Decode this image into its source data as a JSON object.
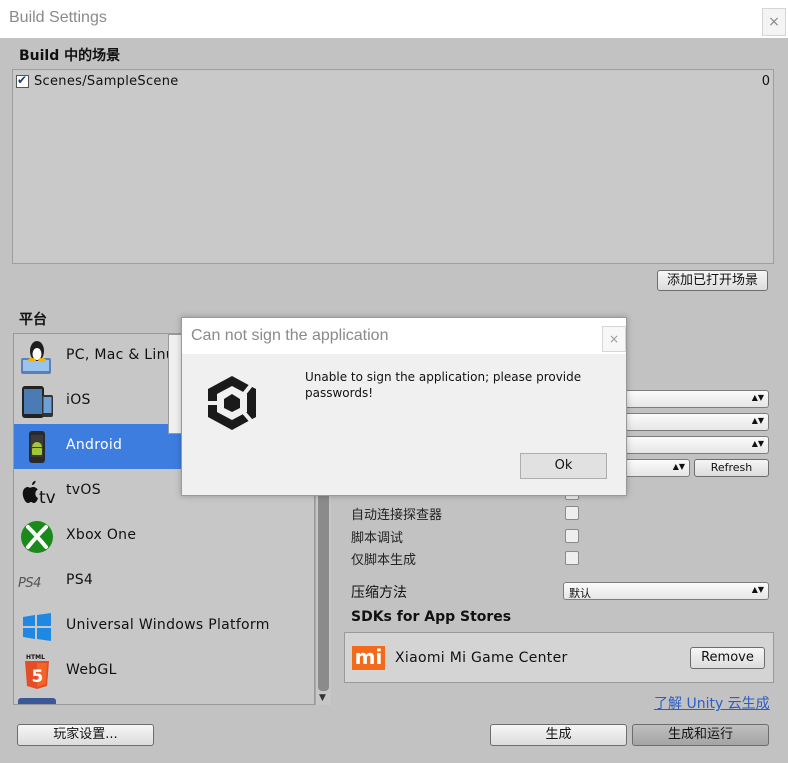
{
  "window": {
    "title": "Build Settings",
    "close_glyph": "×"
  },
  "scenes": {
    "section_label": "Build 中的场景",
    "items": [
      {
        "name": "Scenes/SampleScene",
        "index": "0",
        "checked": true
      }
    ],
    "add_open_button": "添加已打开场景"
  },
  "platforms": {
    "section_label": "平台",
    "items": [
      {
        "label": "PC, Mac & Linux Standalone",
        "icon": "pc-mac-linux-icon"
      },
      {
        "label": "iOS",
        "icon": "ios-icon"
      },
      {
        "label": "Android",
        "icon": "android-icon",
        "selected": true
      },
      {
        "label": "tvOS",
        "icon": "tvos-icon"
      },
      {
        "label": "Xbox One",
        "icon": "xbox-icon"
      },
      {
        "label": "PS4",
        "icon": "ps4-icon"
      },
      {
        "label": "Universal Windows Platform",
        "icon": "windows-icon"
      },
      {
        "label": "WebGL",
        "icon": "html5-icon"
      }
    ]
  },
  "settings": {
    "refresh_button": "Refresh",
    "options": [
      {
        "label": "自动连接探查器",
        "checked": false
      },
      {
        "label": "脚本调试",
        "checked": false
      },
      {
        "label": "仅脚本生成",
        "checked": false
      }
    ],
    "compression_label": "压缩方法",
    "compression_value": "默认"
  },
  "sdks": {
    "section_label": "SDKs for App Stores",
    "items": [
      {
        "name": "Xiaomi Mi Game Center",
        "logo_text": "mi",
        "button": "Remove"
      }
    ],
    "learn_link": "了解 Unity 云生成"
  },
  "bottom": {
    "player_settings": "玩家设置...",
    "build": "生成",
    "build_and_run": "生成和运行"
  },
  "dialog": {
    "title": "Can not sign the application",
    "message": "Unable to sign the application; please provide passwords!",
    "ok": "Ok",
    "close_glyph": "×",
    "icon": "unity-logo-icon"
  },
  "colors": {
    "selection": "#3e7de0",
    "xbox_green": "#1a8a1a",
    "windows_blue": "#1e88e5",
    "html5_orange": "#e44d26",
    "mi_orange": "#f26a1b"
  }
}
